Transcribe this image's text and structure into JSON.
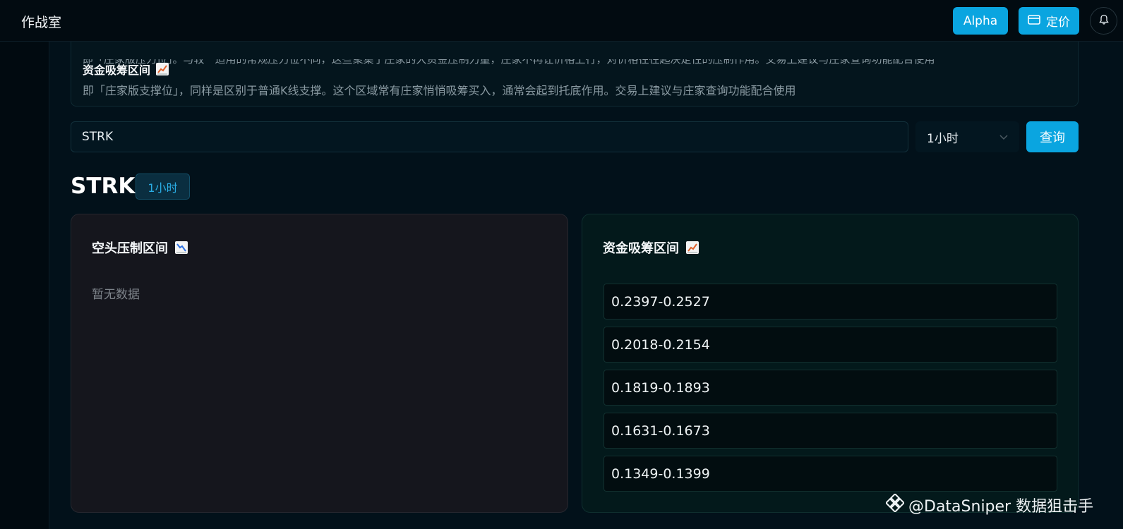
{
  "header": {
    "title": "作战室",
    "alpha_label": "Alpha",
    "pricing_label": "定价"
  },
  "info": {
    "partial_text": "即「庄家版压力位」。与较一适用的常规压力位不同，这些聚集了庄家的大资金压制力量，庄家不再让价格上行，对价格往往起决定性的压制作用。交易上建议与庄家查询功能配合使用",
    "title": "资金吸筹区间",
    "description": "即「庄家版支撑位」，同样是区别于普通K线支撑。这个区域常有庄家悄悄吸筹买入，通常会起到托底作用。交易上建议与庄家查询功能配合使用"
  },
  "search": {
    "value": "STRK",
    "interval": "1小时",
    "query_label": "查询"
  },
  "result": {
    "symbol": "STRK",
    "interval_badge": "1小时"
  },
  "panels": {
    "short": {
      "title": "空头压制区间",
      "empty_text": "暂无数据"
    },
    "accumulation": {
      "title": "资金吸筹区间",
      "ranges": [
        "0.2397-0.2527",
        "0.2018-0.2154",
        "0.1819-0.1893",
        "0.1631-0.1673",
        "0.1349-0.1399"
      ]
    }
  },
  "watermark": {
    "text": "@DataSniper 数据狙击手"
  },
  "colors": {
    "accent": "#0aa5e0",
    "background": "#02111a"
  },
  "icons": {
    "short_title_emoji": "chart-decreasing-icon",
    "accumulation_title_emoji": "chart-increasing-icon",
    "pricing": "card-icon",
    "bell": "bell-icon",
    "select": "chevron-down-icon"
  }
}
